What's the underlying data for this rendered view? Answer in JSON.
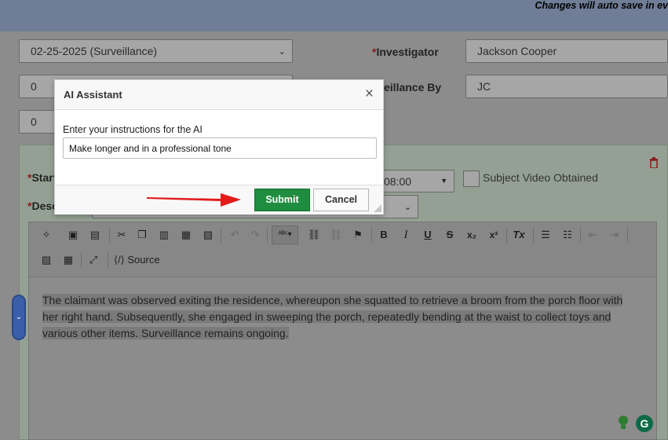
{
  "header": {
    "autosave_notice": "Changes will auto save in ev"
  },
  "form": {
    "date_select": "02-25-2025 (Surveillance)",
    "field_a": "0",
    "field_b": "0",
    "investigator_label": "Investigator",
    "investigator_value": "Jackson Cooper",
    "surveillance_by_label": "eillance By",
    "surveillance_by_value": "JC",
    "start_label": "Start",
    "desc_label": "Desc",
    "time_value": "08:00",
    "subject_video_label": "Subject Video Obtained",
    "required_marker": "*"
  },
  "editor": {
    "source_label": "Source",
    "content": "The claimant was observed exiting the residence, whereupon she squatted to retrieve a broom from the porch floor with her right hand. Subsequently, she engaged in sweeping the porch, repeatedly bending at the waist to collect toys and various other items. Surveillance remains ongoing."
  },
  "modal": {
    "title": "AI Assistant",
    "close": "×",
    "instruction_label": "Enter your instructions for the AI",
    "instruction_value": "Make longer and in a professional tone",
    "submit_label": "Submit",
    "cancel_label": "Cancel"
  },
  "icons": {
    "trash": "trash-icon",
    "side_tab": "chevron-down-icon",
    "grammarly": "G"
  },
  "colors": {
    "submit_green": "#1f8c3f",
    "arrow_red": "#e21b1b",
    "required_red": "#8b1b1b",
    "side_tab_blue": "#3b5ea9"
  }
}
